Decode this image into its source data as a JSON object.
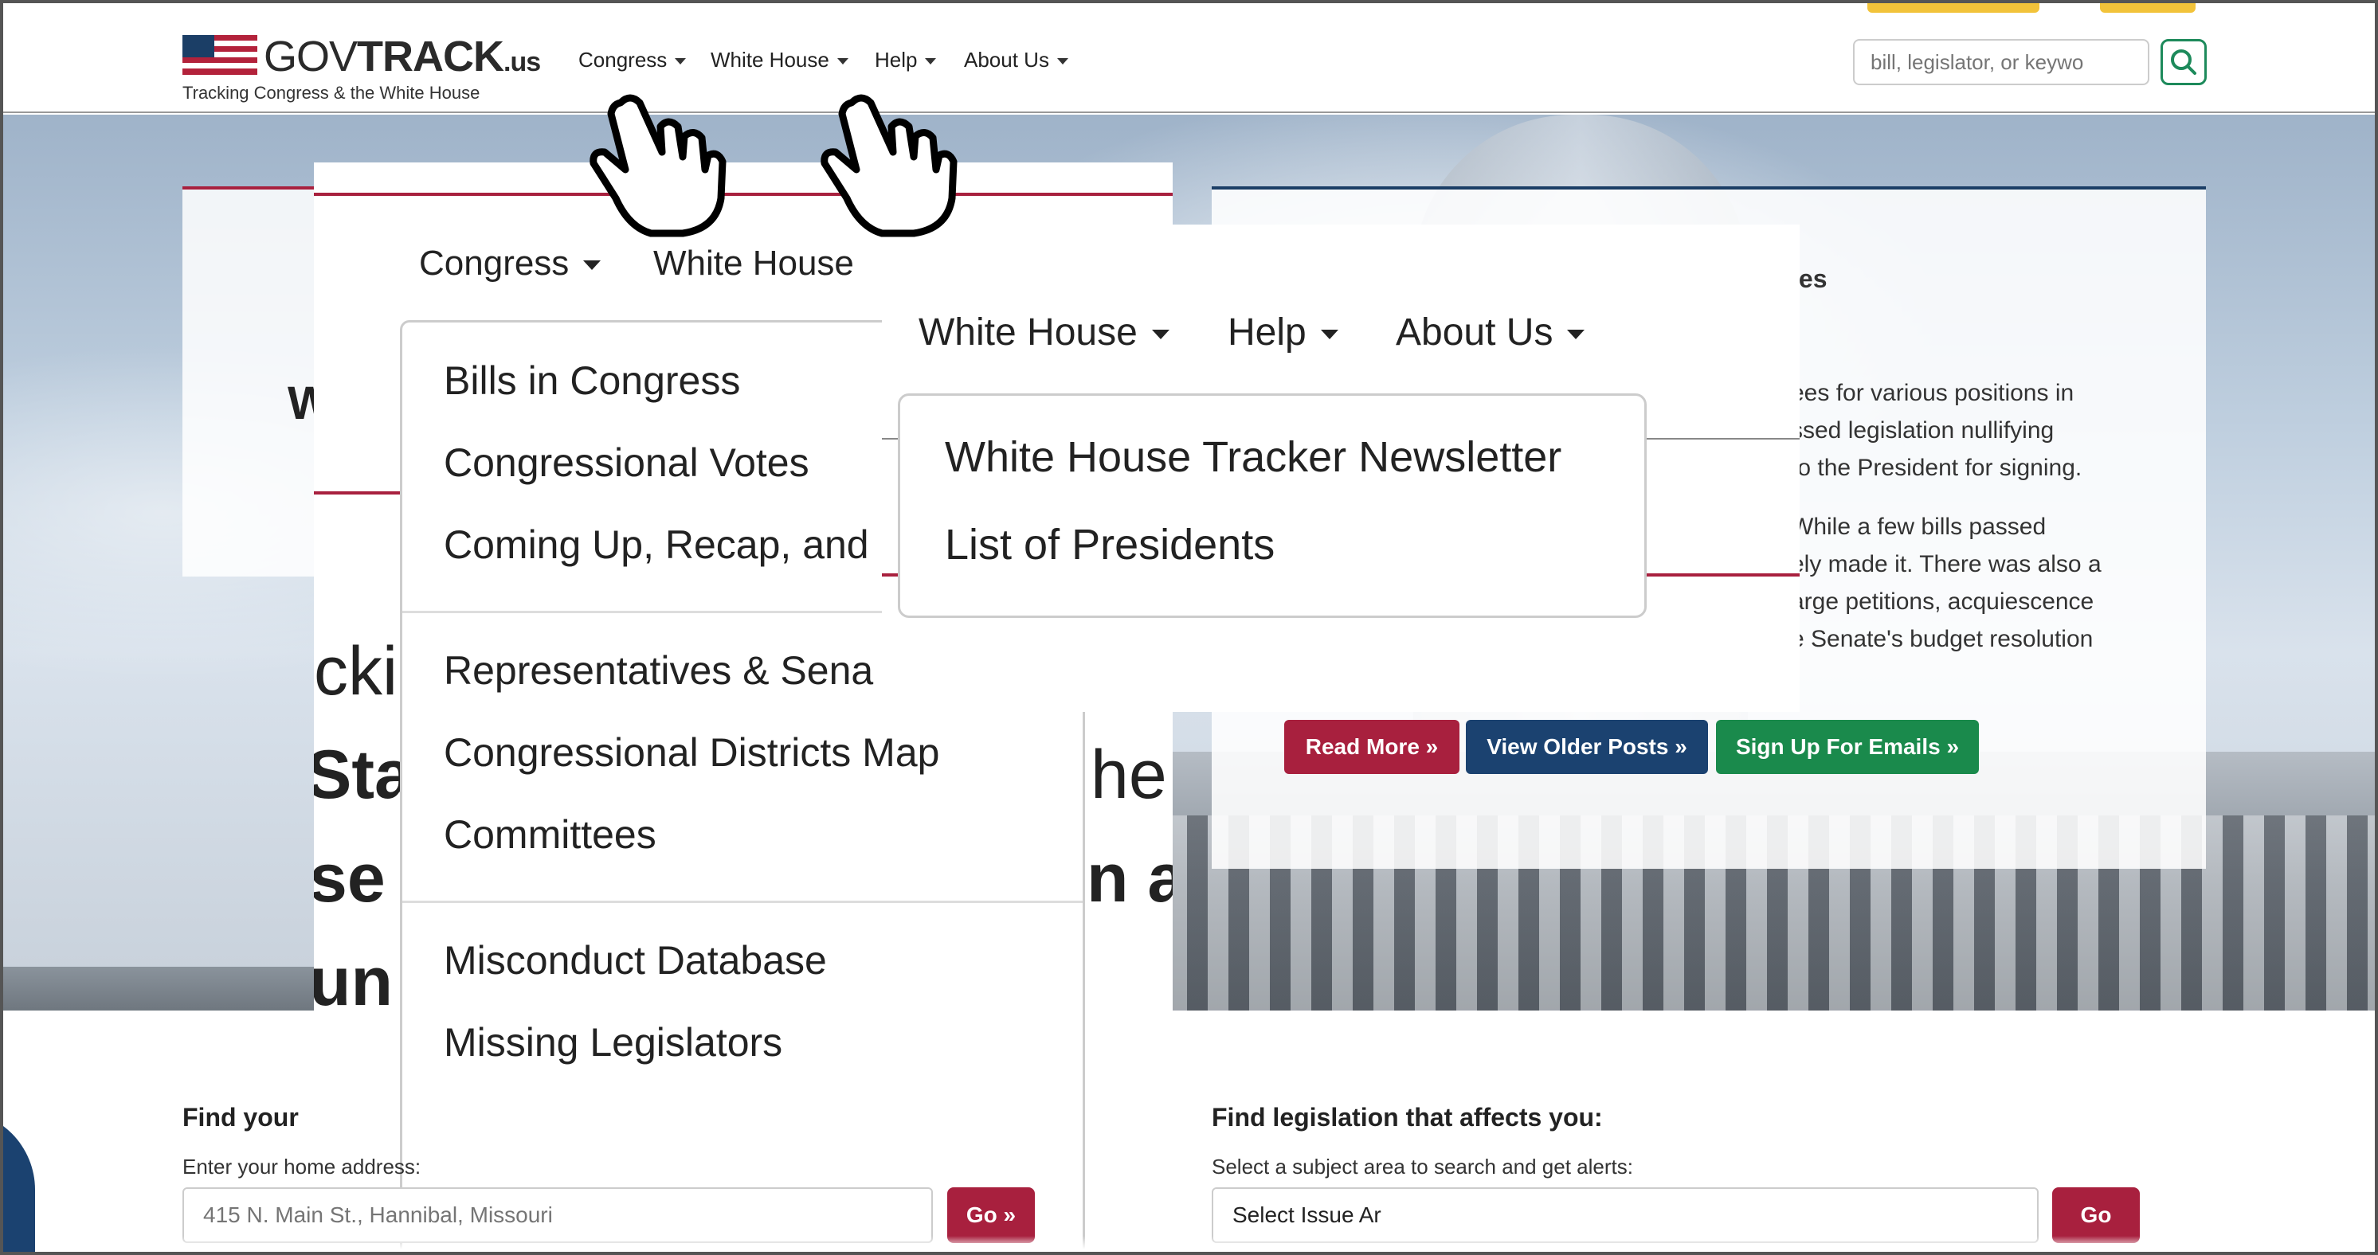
{
  "header": {
    "logo": {
      "brand_light": "GOV",
      "brand_bold": "TRACK",
      "brand_suffix": ".us",
      "tagline": "Tracking Congress & the White House"
    },
    "nav": [
      {
        "label": "Congress"
      },
      {
        "label": "White House"
      },
      {
        "label": "Help"
      },
      {
        "label": "About Us"
      }
    ],
    "search": {
      "placeholder": "bill, legislator, or keywo"
    }
  },
  "hero": {
    "left_card_fragment": "W",
    "background_text_fragments": [
      "cki",
      "Sta",
      "he",
      "se",
      "n a",
      "un"
    ],
    "right_card": {
      "heading_fragment": "ies",
      "paragraph1": [
        "ees for various positions in",
        "ssed legislation nullifying",
        "to the President for signing."
      ],
      "paragraph2": [
        "While a few bills passed",
        "ely made it. There was also a",
        "arge petitions, acquiescence",
        "e Senate's budget resolution"
      ]
    },
    "buttons": {
      "read_more": "Read More »",
      "view_older": "View Older Posts »",
      "sign_up": "Sign Up For Emails »"
    }
  },
  "zoom_congress": {
    "nav": {
      "congress": "Congress",
      "white_house": "White House"
    },
    "items": [
      "Bills in Congress",
      "Congressional Votes",
      "Coming Up, Recap, and",
      "Representatives & Sena",
      "Congressional Districts Map",
      "Committees",
      "Misconduct Database",
      "Missing Legislators"
    ]
  },
  "zoom_white_house": {
    "nav": {
      "white_house": "White House",
      "help": "Help",
      "about": "About Us"
    },
    "items": [
      "White House Tracker Newsletter",
      "List of Presidents"
    ]
  },
  "find_rep": {
    "title": "Find your",
    "subtitle": "Enter your home address:",
    "placeholder": "415 N. Main St., Hannibal, Missouri",
    "go": "Go »"
  },
  "find_legislation": {
    "title": "Find legislation that affects you:",
    "subtitle": "Select a subject area to search and get alerts:",
    "select_value": "Select Issue Ar",
    "go": "Go"
  },
  "colors": {
    "brand_red": "#a8203e",
    "brand_blue": "#1b4270",
    "brand_green": "#1a8a4c",
    "accent_yellow": "#f2c33a"
  },
  "icons": [
    "us-flag-icon",
    "search-icon",
    "hand-pointer-icon"
  ]
}
